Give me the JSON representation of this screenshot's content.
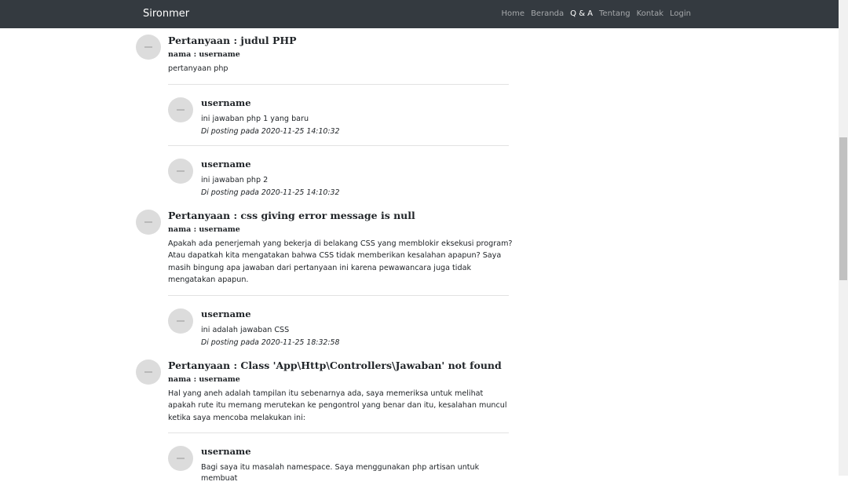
{
  "navbar": {
    "brand": "Sironmer",
    "items": [
      {
        "label": "Home"
      },
      {
        "label": "Beranda"
      },
      {
        "label": "Q & A"
      },
      {
        "label": "Tentang"
      },
      {
        "label": "Kontak"
      },
      {
        "label": "Login"
      }
    ],
    "active_item": "Q & A"
  },
  "questions": [
    {
      "title": "Pertanyaan : judul PHP",
      "name": "nama : username",
      "body": "pertanyaan php",
      "answers": [
        {
          "user": "username",
          "body": "ini jawaban php 1 yang baru",
          "date": "Di posting pada 2020-11-25 14:10:32"
        },
        {
          "user": "username",
          "body": "ini jawaban php 2",
          "date": "Di posting pada 2020-11-25 14:10:32"
        }
      ]
    },
    {
      "title": "Pertanyaan : css giving error message is null",
      "name": "nama : username",
      "body": "Apakah ada penerjemah yang bekerja di belakang CSS yang memblokir eksekusi program? Atau dapatkah kita mengatakan bahwa CSS tidak memberikan kesalahan apapun? Saya masih bingung apa jawaban dari pertanyaan ini karena pewawancara juga tidak mengatakan apapun.",
      "answers": [
        {
          "user": "username",
          "body": "ini adalah jawaban CSS",
          "date": "Di posting pada 2020-11-25 18:32:58"
        }
      ]
    },
    {
      "title": "Pertanyaan : Class 'App\\Http\\Controllers\\Jawaban' not found",
      "name": "nama : username",
      "body": "Hal yang aneh adalah tampilan itu sebenarnya ada, saya memeriksa untuk melihat apakah rute itu memang merutekan ke pengontrol yang benar dan itu, kesalahan muncul ketika saya mencoba melakukan ini:",
      "answers": [
        {
          "user": "username",
          "body": "Bagi saya itu masalah namespace. Saya menggunakan php artisan untuk membuat",
          "date": ""
        }
      ]
    }
  ]
}
